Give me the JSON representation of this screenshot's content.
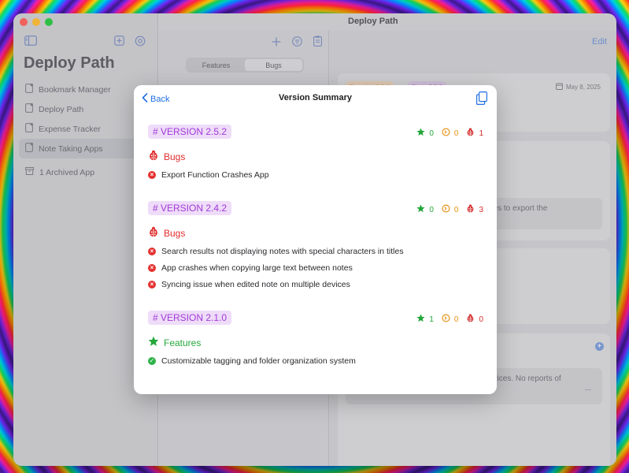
{
  "window": {
    "title": "Deploy Path",
    "traffic_colors": [
      "#fe5f57",
      "#febc2e",
      "#28c840"
    ]
  },
  "sidebar": {
    "title": "Deploy Path",
    "items": [
      {
        "label": "Bookmark Manager",
        "icon": "app-doc-icon"
      },
      {
        "label": "Deploy Path",
        "icon": "app-doc-icon"
      },
      {
        "label": "Expense Tracker",
        "icon": "app-doc-icon"
      },
      {
        "label": "Note Taking Apps",
        "icon": "app-doc-icon"
      }
    ],
    "archived_label": "1 Archived App"
  },
  "middle": {
    "segments": [
      "Features",
      "Bugs"
    ],
    "selected_segment": "Bugs"
  },
  "detail": {
    "edit_label": "Edit",
    "found_tag": "Found in 2.5.1",
    "fix_tag": "Fix in 2.5.2",
    "date": "May 8, 2025",
    "text_1": "ries to export the",
    "text_2": "evices. No reports of",
    "ellipsis": "...",
    "plus_symbol": "+"
  },
  "modal": {
    "back_label": "Back",
    "title": "Version Summary",
    "versions": [
      {
        "label": "# VERSION 2.5.2",
        "counts": {
          "features": "0",
          "in_progress": "0",
          "bugs": "1"
        },
        "section": "Bugs",
        "items": [
          "Export Function Crashes App"
        ]
      },
      {
        "label": "# VERSION 2.4.2",
        "counts": {
          "features": "0",
          "in_progress": "0",
          "bugs": "3"
        },
        "section": "Bugs",
        "items": [
          "Search results not displaying notes with special characters in titles",
          "App crashes when copying large text between notes",
          "Syncing issue when edited note on multiple devices"
        ]
      },
      {
        "label": "# VERSION 2.1.0",
        "counts": {
          "features": "1",
          "in_progress": "0",
          "bugs": "0"
        },
        "section": "Features",
        "items": [
          "Customizable tagging and folder organization system"
        ]
      }
    ]
  },
  "colors": {
    "accent_blue": "#1f6fe0",
    "version_purple": "#a23ad7",
    "bug_red": "#e02d2d",
    "feature_green": "#27a83c",
    "progress_orange": "#e69112"
  }
}
